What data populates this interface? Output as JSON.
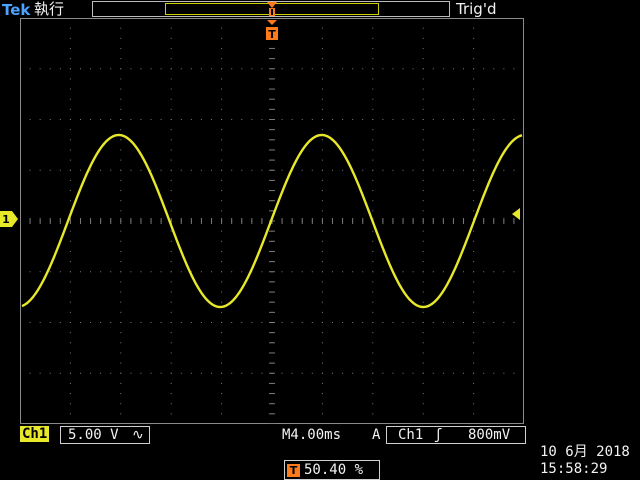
{
  "header": {
    "brand": "Tek",
    "acquisition_status": "執行",
    "trigger_status": "Trig'd",
    "trigger_icon": "T"
  },
  "display": {
    "trace_color": "#e8e82a",
    "grid_color": "#7a7a7a",
    "trigger_marker_color": "#ff7a1a",
    "channel_marker": "1"
  },
  "channel1": {
    "tag": "Ch1",
    "scale": "5.00 V",
    "coupling_icon": "∿"
  },
  "horizontal": {
    "timebase": "M4.00ms"
  },
  "trigger": {
    "mode": "A",
    "source": "Ch1",
    "slope_icon": "ʃ",
    "level": "800mV",
    "position_icon": "T",
    "position": "50.40 %"
  },
  "datetime": {
    "date": "10 6月  2018",
    "time": "15:58:29"
  }
}
